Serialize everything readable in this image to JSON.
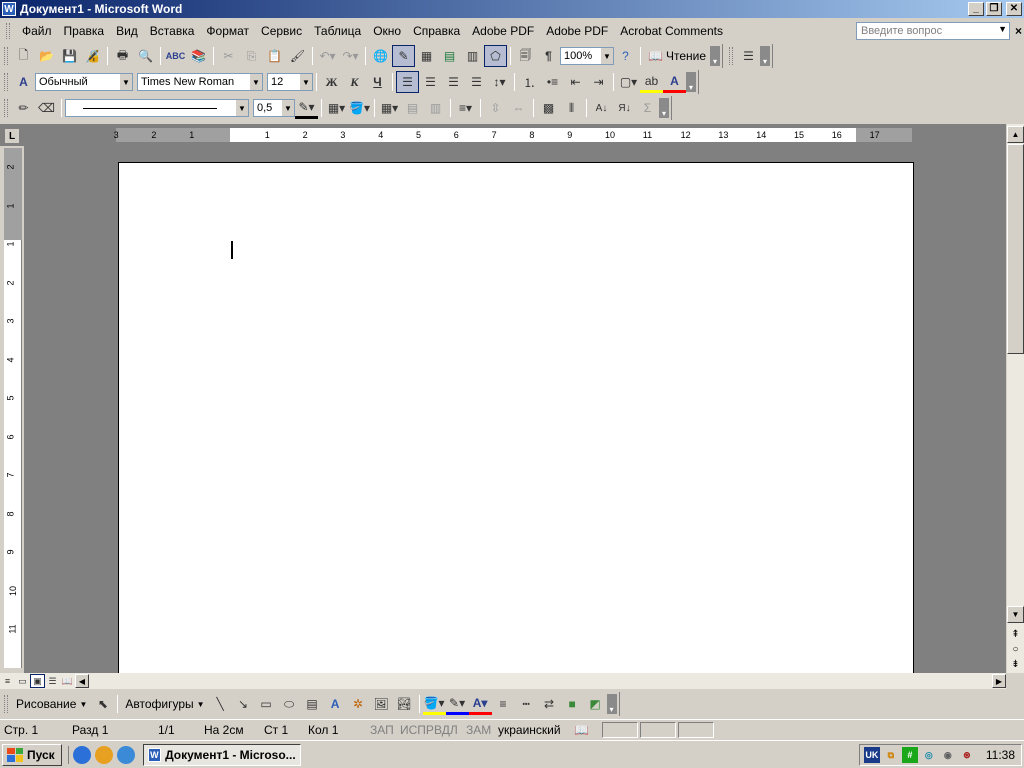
{
  "window": {
    "title": "Документ1 - Microsoft Word",
    "app_icon": "W",
    "controls": {
      "minimize": "_",
      "restore": "❐",
      "close": "✕"
    }
  },
  "menu": {
    "items": [
      "Файл",
      "Правка",
      "Вид",
      "Вставка",
      "Формат",
      "Сервис",
      "Таблица",
      "Окно",
      "Справка",
      "Adobe PDF",
      "Adobe PDF",
      "Acrobat Comments"
    ],
    "help_placeholder": "Введите вопрос",
    "doc_close": "×"
  },
  "standard_toolbar": {
    "zoom": "100%",
    "read_label": "Чтение"
  },
  "formatting_toolbar": {
    "style": "Обычный",
    "font": "Times New Roman",
    "size": "12",
    "bold": "Ж",
    "italic": "К",
    "underline": "Ч"
  },
  "tables_toolbar": {
    "line_weight": "0,5"
  },
  "ruler": {
    "left_labels": [
      "3",
      "2",
      "1"
    ],
    "labels": [
      "1",
      "2",
      "3",
      "4",
      "5",
      "6",
      "7",
      "8",
      "9",
      "10",
      "11",
      "12",
      "13",
      "14",
      "15",
      "16",
      "17"
    ],
    "vertical_labels": [
      "2",
      "1",
      "1",
      "2",
      "3",
      "4",
      "5",
      "6",
      "7",
      "8",
      "9",
      "10",
      "11"
    ]
  },
  "drawing_toolbar": {
    "drawing_label": "Рисование",
    "autoshapes_label": "Автофигуры"
  },
  "status": {
    "page": "Стр. 1",
    "section": "Разд 1",
    "pages": "1/1",
    "at": "На 2см",
    "line": "Ст 1",
    "col": "Кол 1",
    "rec": "ЗАП",
    "trk": "ИСПР",
    "ext": "ВДЛ",
    "ovr": "ЗАМ",
    "language": "украинский"
  },
  "taskbar": {
    "start_label": "Пуск",
    "task_label": "Документ1 - Microso...",
    "clock": "11:38",
    "tray_lang": "UK"
  }
}
